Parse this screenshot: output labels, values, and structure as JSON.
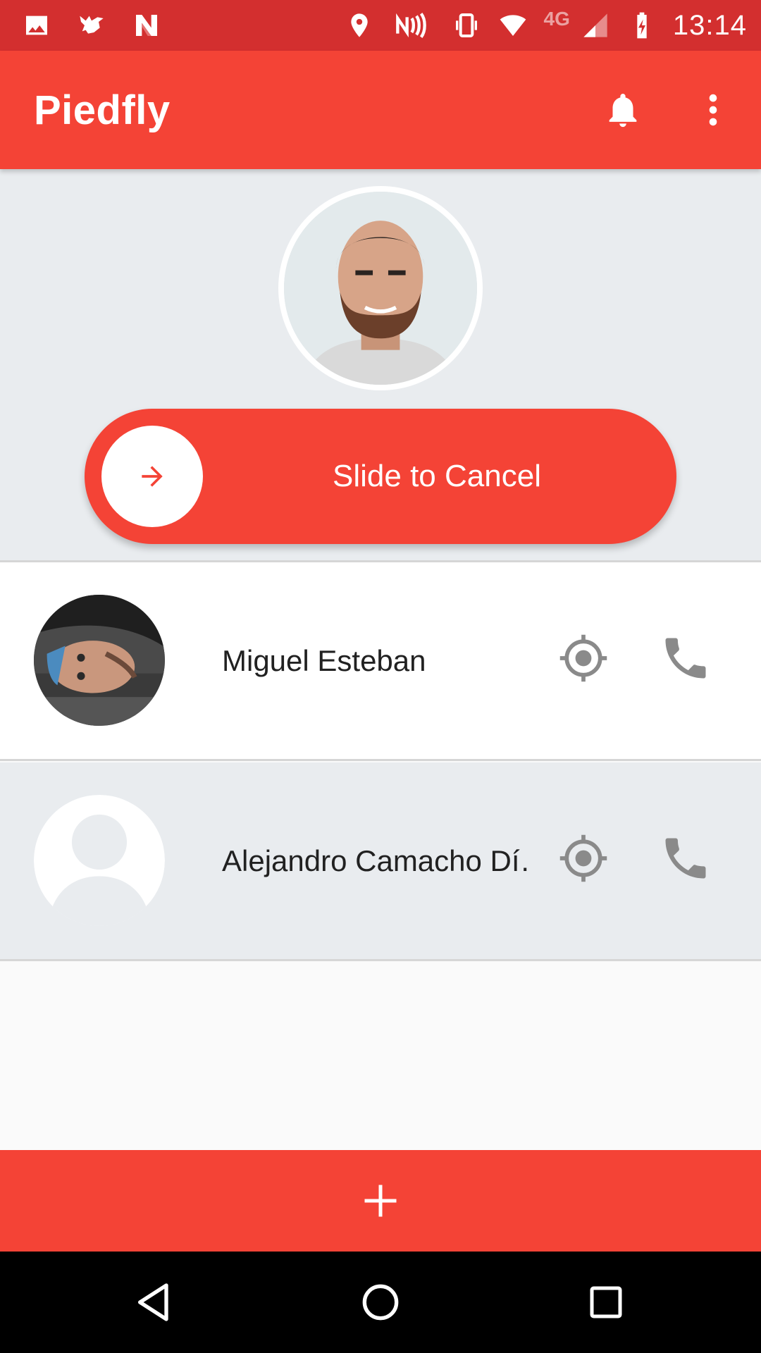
{
  "status_bar": {
    "left_icons": [
      "image-icon",
      "bird-icon",
      "n-app-icon"
    ],
    "right_icons": [
      "location-icon",
      "nfc-icon",
      "vibrate-icon",
      "wifi-icon",
      "network-4g-icon",
      "signal-icon",
      "battery-charging-icon"
    ],
    "network_label": "4G",
    "time": "13:14"
  },
  "app_bar": {
    "title": "Piedfly",
    "actions": [
      "bell-icon",
      "more-vert-icon"
    ]
  },
  "slider": {
    "label": "Slide to Cancel",
    "knob_icon": "arrow-right-icon"
  },
  "contacts": [
    {
      "name": "Miguel Esteban",
      "avatar": "photo",
      "actions": [
        "locate-icon",
        "phone-icon"
      ]
    },
    {
      "name": "Alejandro Camacho Dí…",
      "avatar": "placeholder",
      "actions": [
        "locate-icon",
        "phone-icon"
      ]
    }
  ],
  "fab": {
    "label": "+",
    "icon": "add-icon"
  },
  "nav": [
    "back-icon",
    "home-icon",
    "recents-icon"
  ],
  "colors": {
    "status_bar": "#d32f2f",
    "primary": "#f44336",
    "panel": "#e9ecef",
    "icon_gray": "#8a8a8a"
  }
}
